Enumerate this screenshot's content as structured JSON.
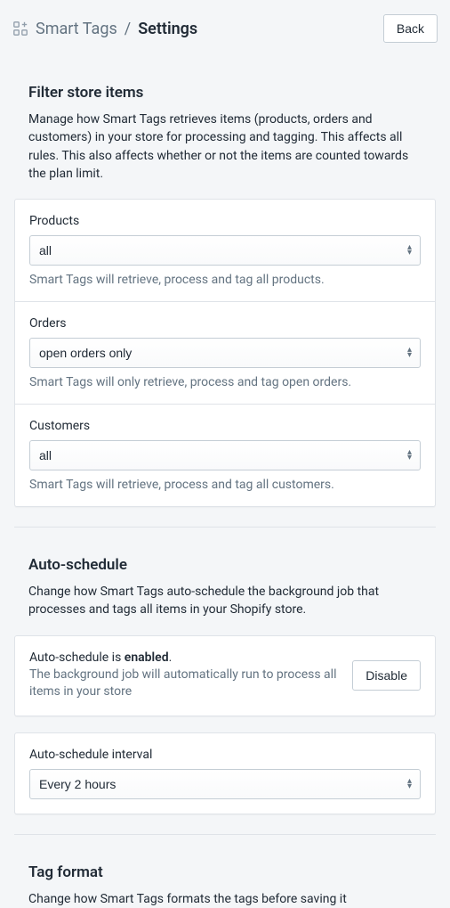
{
  "header": {
    "app_name": "Smart Tags",
    "separator": "/",
    "current": "Settings",
    "back_label": "Back"
  },
  "filter": {
    "title": "Filter store items",
    "desc": "Manage how Smart Tags retrieves items (products, orders and customers) in your store for processing and tagging. This affects all rules. This also affects whether or not the items are counted towards the plan limit.",
    "products": {
      "label": "Products",
      "value": "all",
      "help": "Smart Tags will retrieve, process and tag all products."
    },
    "orders": {
      "label": "Orders",
      "value": "open orders only",
      "help": "Smart Tags will only retrieve, process and tag open orders."
    },
    "customers": {
      "label": "Customers",
      "value": "all",
      "help": "Smart Tags will retrieve, process and tag all customers."
    }
  },
  "auto": {
    "title": "Auto-schedule",
    "desc": "Change how Smart Tags auto-schedule the background job that processes and tags all items in your Shopify store.",
    "status_prefix": "Auto-schedule is ",
    "status_value": "enabled",
    "status_suffix": ".",
    "sub": "The background job will automatically run to process all items in your store",
    "disable_label": "Disable",
    "interval_label": "Auto-schedule interval",
    "interval_value": "Every 2 hours"
  },
  "tagformat": {
    "title": "Tag format",
    "desc": "Change how Smart Tags formats the tags before saving it"
  }
}
